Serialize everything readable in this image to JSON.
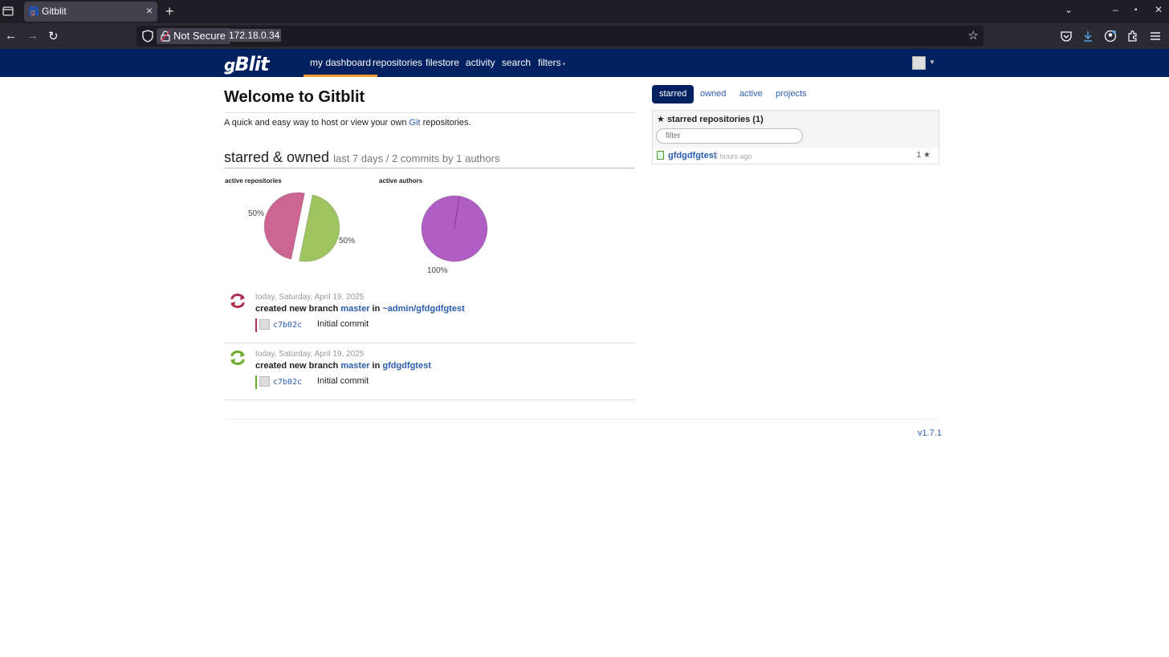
{
  "browser": {
    "tab_title": "Gitblit",
    "new_tab": "+",
    "security_label": "Not Secure",
    "url": "172.18.0.34"
  },
  "header": {
    "logo": "Blit",
    "nav": [
      "my dashboard",
      "repositories",
      "filestore",
      "activity",
      "search",
      "filters"
    ]
  },
  "main": {
    "title": "Welcome to Gitblit",
    "lead_before": "A quick and easy way to host or view your own ",
    "lead_link": "Git",
    "lead_after": " repositories.",
    "section_title": "starred & owned",
    "section_sub": "last 7 days / 2 commits by 1 authors"
  },
  "charts": {
    "repos_label": "active repositories",
    "authors_label": "active authors"
  },
  "chart_data": [
    {
      "type": "pie",
      "title": "active repositories",
      "labels": [
        "50%",
        "50%"
      ],
      "values": [
        50,
        50
      ],
      "colors": [
        "#9dc45f",
        "#cc6691"
      ]
    },
    {
      "type": "pie",
      "title": "active authors",
      "labels": [
        "100%"
      ],
      "values": [
        100
      ],
      "colors": [
        "#b05ec4"
      ]
    }
  ],
  "activity": [
    {
      "date": "today, Saturday, April 19, 2025",
      "action": "created new branch",
      "branch": "master",
      "in": "in",
      "repo": "~admin/gfdgdfgtest",
      "hash": "c7b02c",
      "message": "Initial commit",
      "color": "#b03050"
    },
    {
      "date": "today, Saturday, April 19, 2025",
      "action": "created new branch",
      "branch": "master",
      "in": "in",
      "repo": "gfdgdfgtest",
      "hash": "c7b02c",
      "message": "Initial commit",
      "color": "#6aaa2a"
    }
  ],
  "right": {
    "tabs": [
      "starred",
      "owned",
      "active",
      "projects"
    ],
    "starred_title": "starred repositories (1)",
    "filter_placeholder": "filter",
    "repo": {
      "name": "gfdgdfgtest",
      "time": "2 hours ago",
      "stars": "1 ★"
    }
  },
  "footer": {
    "version": "v1.7.1"
  }
}
